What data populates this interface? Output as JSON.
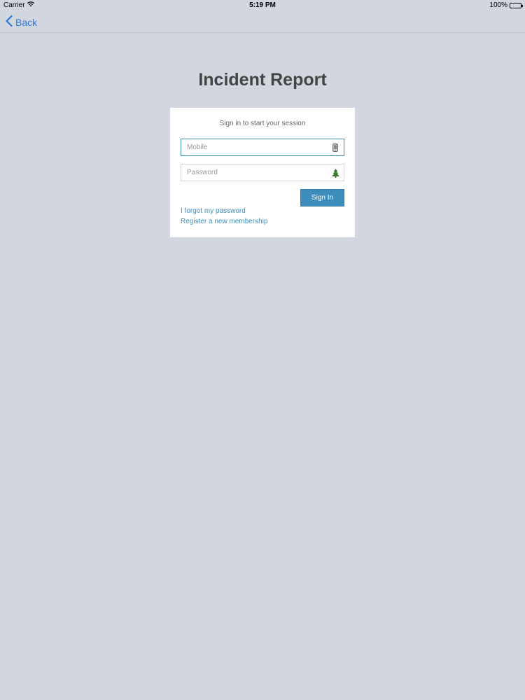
{
  "status_bar": {
    "carrier": "Carrier",
    "time": "5:19 PM",
    "battery": "100%"
  },
  "nav": {
    "back_label": "Back"
  },
  "page": {
    "title": "Incident Report"
  },
  "login": {
    "message": "Sign in to start your session",
    "mobile_placeholder": "Mobile",
    "password_placeholder": "Password",
    "signin_label": "Sign In",
    "forgot_label": "I forgot my password",
    "register_label": "Register a new membership"
  },
  "icons": {
    "mobile": "mobile-phone-icon",
    "password": "tree-icon"
  },
  "colors": {
    "background": "#d2d6de",
    "accent": "#3c8dbc",
    "ios_blue": "#2b7ae0",
    "title": "#444444"
  }
}
